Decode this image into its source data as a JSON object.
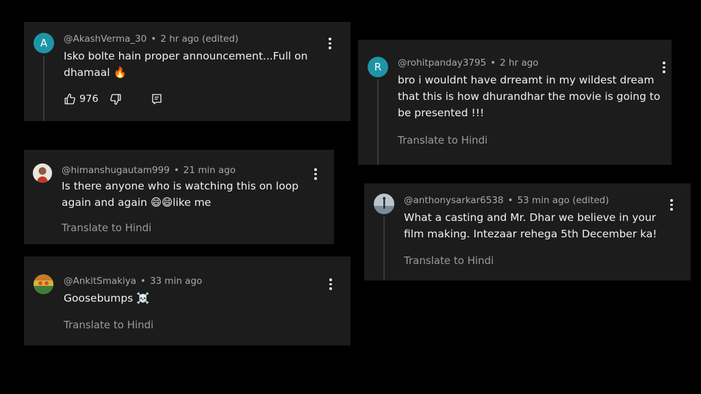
{
  "colors": {
    "background": "#000000",
    "card": "#1c1c1c",
    "meta_text": "#aaaaaa",
    "body_text": "#f1f1f1",
    "translate_text": "#9a9a9a",
    "avatar_teal": "#1e95a5"
  },
  "comments": [
    {
      "handle": "@AkashVerma_30",
      "time": "2 hr ago (edited)",
      "avatar_letter": "A",
      "avatar_color": "#1e95a5",
      "text_lines": [
        "Isko bolte hain proper announcement...Full on",
        "dhamaal 🔥"
      ],
      "likes": "976",
      "icons": [
        "thumbs-up-icon",
        "thumbs-down-icon",
        "reply-icon",
        "more-vert-icon"
      ]
    },
    {
      "handle": "@himanshugautam999",
      "time": "21 min ago",
      "avatar_icon": "profile-photo",
      "text_lines": [
        "Is there anyone who is watching this on loop",
        "again and again 😄😄like me"
      ],
      "translate": "Translate to Hindi"
    },
    {
      "handle": "@AnkitSmakiya",
      "time": "33 min ago",
      "avatar_icon": "profile-photo",
      "text_lines": [
        "Goosebumps ☠️"
      ],
      "translate": "Translate to Hindi"
    },
    {
      "handle": "@rohitpanday3795",
      "time": "2 hr ago",
      "avatar_letter": "R",
      "avatar_color": "#1e95a5",
      "text_lines": [
        "bro i wouldnt have drreamt in my wildest dream",
        "that this is how dhurandhar the movie is going to",
        "be presented !!!"
      ],
      "translate": "Translate to Hindi"
    },
    {
      "handle": "@anthonysarkar6538",
      "time": "53 min ago (edited)",
      "avatar_icon": "profile-photo",
      "text_lines": [
        "What a casting and Mr. Dhar we believe in your",
        "film making. Intezaar rehega 5th December ka!"
      ],
      "translate": "Translate to Hindi"
    }
  ]
}
